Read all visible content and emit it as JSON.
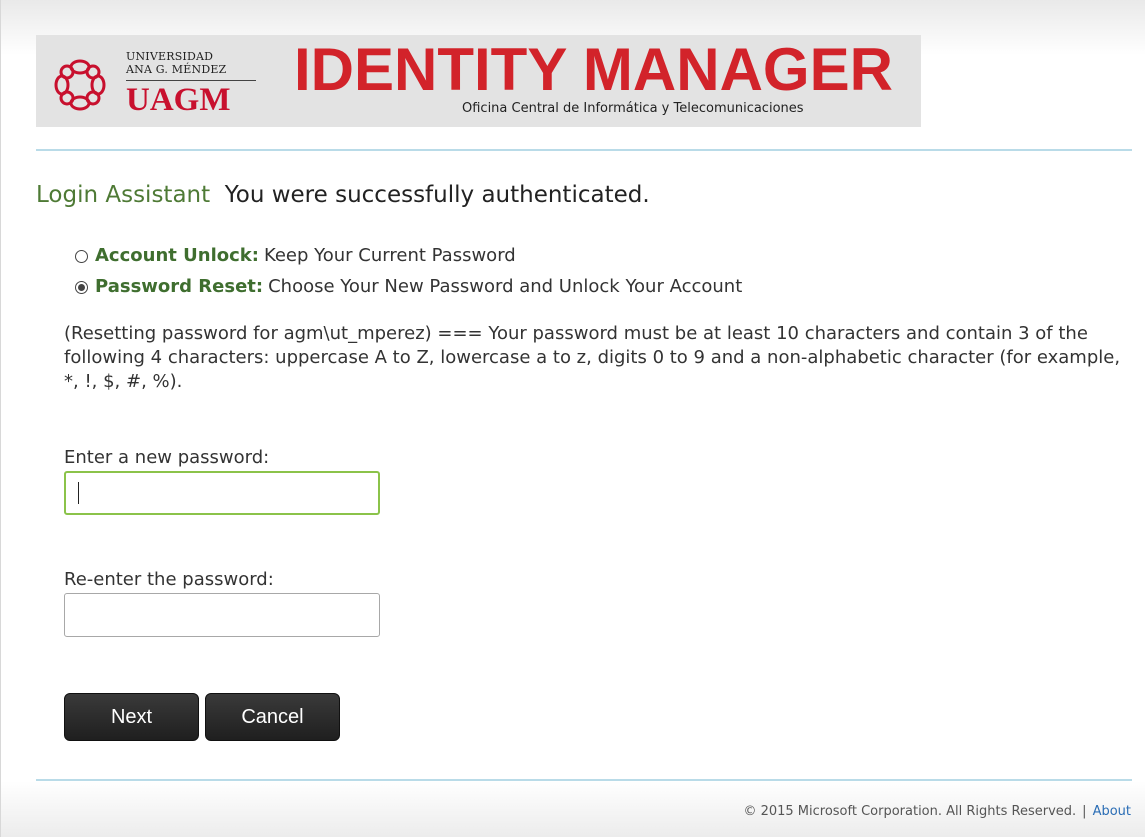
{
  "brand": {
    "university_line1": "UNIVERSIDAD",
    "university_line2": "ANA G. MÉNDEZ",
    "university_abbr": "UAGM",
    "product_title": "IDENTITY MANAGER",
    "product_subtitle": "Oficina Central de Informática y Telecomunicaciones",
    "title_color": "#d2232a",
    "abbr_color": "#c8102e"
  },
  "heading": {
    "assistant": "Login Assistant",
    "message": "You were successfully authenticated."
  },
  "options": [
    {
      "label": "Account Unlock:",
      "description": "Keep Your Current Password",
      "selected": false
    },
    {
      "label": "Password Reset:",
      "description": "Choose Your New Password and Unlock Your Account",
      "selected": true
    }
  ],
  "instructions": "(Resetting password for agm\\ut_mperez) === Your password must be at least 10 characters and contain 3 of the following 4 characters: uppercase A to Z, lowercase a to z, digits 0 to 9 and a non-alphabetic character (for example, *, !, $, #, %).",
  "fields": {
    "new_password": {
      "label": "Enter a new password:",
      "value": ""
    },
    "confirm_password": {
      "label": "Re-enter the password:",
      "value": ""
    }
  },
  "buttons": {
    "next": "Next",
    "cancel": "Cancel"
  },
  "footer": {
    "copyright": "© 2015 Microsoft Corporation. All Rights Reserved.",
    "separator": "|",
    "about": "About"
  },
  "colors": {
    "accent_green": "#4e7a35",
    "option_green": "#3f6e2f",
    "focus_green": "#8bc34a",
    "rule_blue": "#b9dbe8",
    "link_blue": "#2a6db5"
  }
}
